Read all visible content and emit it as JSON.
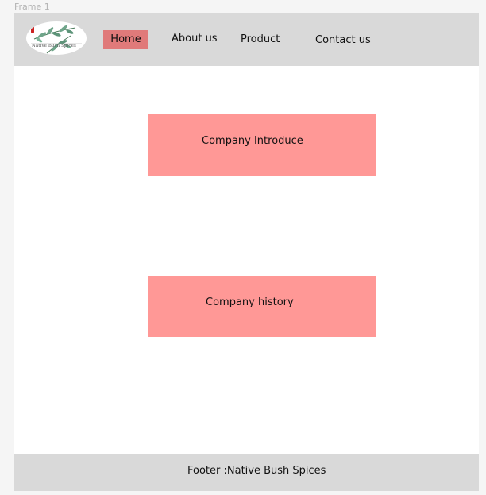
{
  "frame": {
    "label": "Frame 1"
  },
  "header": {
    "logo": {
      "text": "Native Bush Spices",
      "icon": "leaf-branch-logo"
    },
    "nav": {
      "home": "Home",
      "about": "About us",
      "product": "Product",
      "contact": "Contact us"
    },
    "active_color": "#e07a7a"
  },
  "main": {
    "intro_label": "Company Introduce",
    "history_label": "Company history",
    "card_color": "#ff9896"
  },
  "footer": {
    "text": "Footer :Native Bush Spices"
  }
}
